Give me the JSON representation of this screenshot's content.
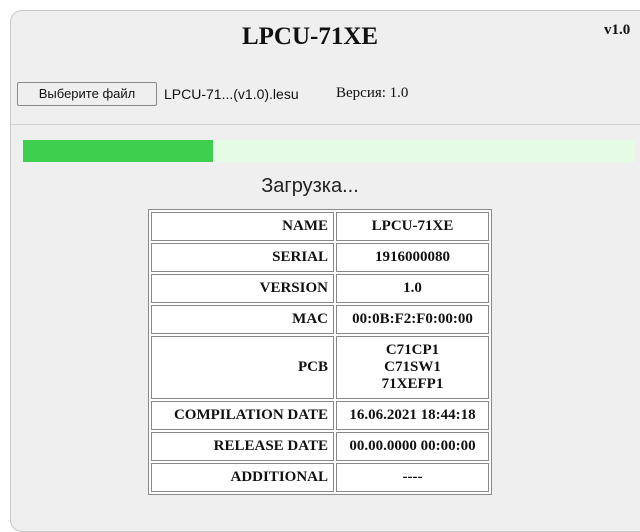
{
  "header": {
    "title": "LPCU-71XE",
    "version": "v1.0"
  },
  "file": {
    "button_label": "Выберите файл",
    "file_name": "LPCU-71...(v1.0).lesu",
    "version_label": "Версия: 1.0"
  },
  "progress": {
    "fraction": 0.31,
    "status": "Загрузка..."
  },
  "info_table": {
    "rows": [
      {
        "key": "NAME",
        "value": "LPCU-71XE"
      },
      {
        "key": "SERIAL",
        "value": "1916000080"
      },
      {
        "key": "VERSION",
        "value": "1.0"
      },
      {
        "key": "MAC",
        "value": "00:0B:F2:F0:00:00"
      },
      {
        "key": "PCB",
        "value": [
          "C71CP1",
          "C71SW1",
          "71XEFP1"
        ]
      },
      {
        "key": "COMPILATION DATE",
        "value": "16.06.2021 18:44:18"
      },
      {
        "key": "RELEASE DATE",
        "value": "00.00.0000 00:00:00"
      },
      {
        "key": "ADDITIONAL",
        "value": "----"
      }
    ]
  },
  "colors": {
    "progress_fill": "#3ecf4f",
    "progress_track": "#e6fbe6",
    "panel": "#efefef"
  }
}
